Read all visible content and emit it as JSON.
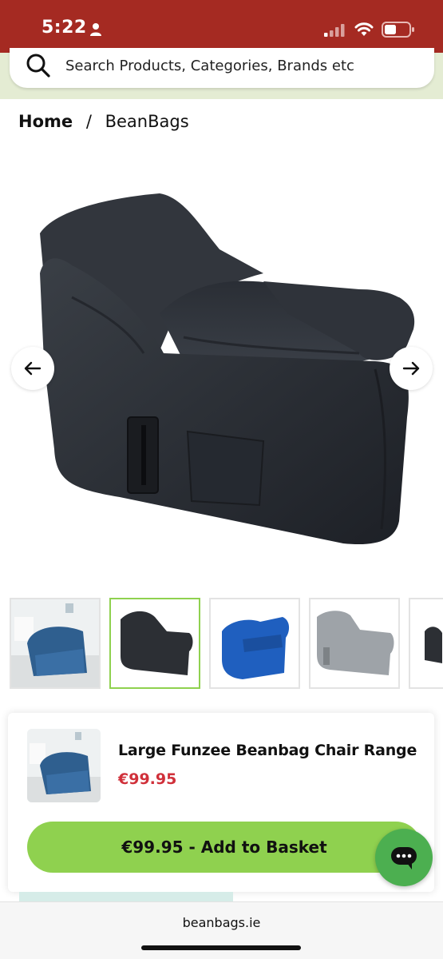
{
  "status_bar": {
    "time": "5:22",
    "background": "#a52a22"
  },
  "search": {
    "placeholder": "Search Products, Categories, Brands etc",
    "icon": "search-icon"
  },
  "breadcrumb": {
    "home": "Home",
    "separator": "/",
    "current": "BeanBags"
  },
  "gallery": {
    "prev_icon": "arrow-left-icon",
    "next_icon": "arrow-right-icon",
    "thumbnails": [
      {
        "name": "blue beanbag chair in room",
        "color": "#2f5f8f"
      },
      {
        "name": "black beanbag chair",
        "color": "#2c2f34",
        "selected": true
      },
      {
        "name": "royal blue beanbag chair",
        "color": "#1f5fbf"
      },
      {
        "name": "grey beanbag chair",
        "color": "#9ea3a8"
      },
      {
        "name": "partial thumbnail",
        "color": "#2c2f34"
      }
    ]
  },
  "product": {
    "title": "Large Funzee Beanbag Chair Range",
    "price": "€99.95",
    "price_color": "#d0303a"
  },
  "basket_button": {
    "price": "€99.95",
    "label": " - Add to Basket",
    "color": "#8fd14f"
  },
  "chat": {
    "icon": "chat-bubble-icon",
    "color": "#4caf50"
  },
  "browser": {
    "url": "beanbags.ie"
  }
}
